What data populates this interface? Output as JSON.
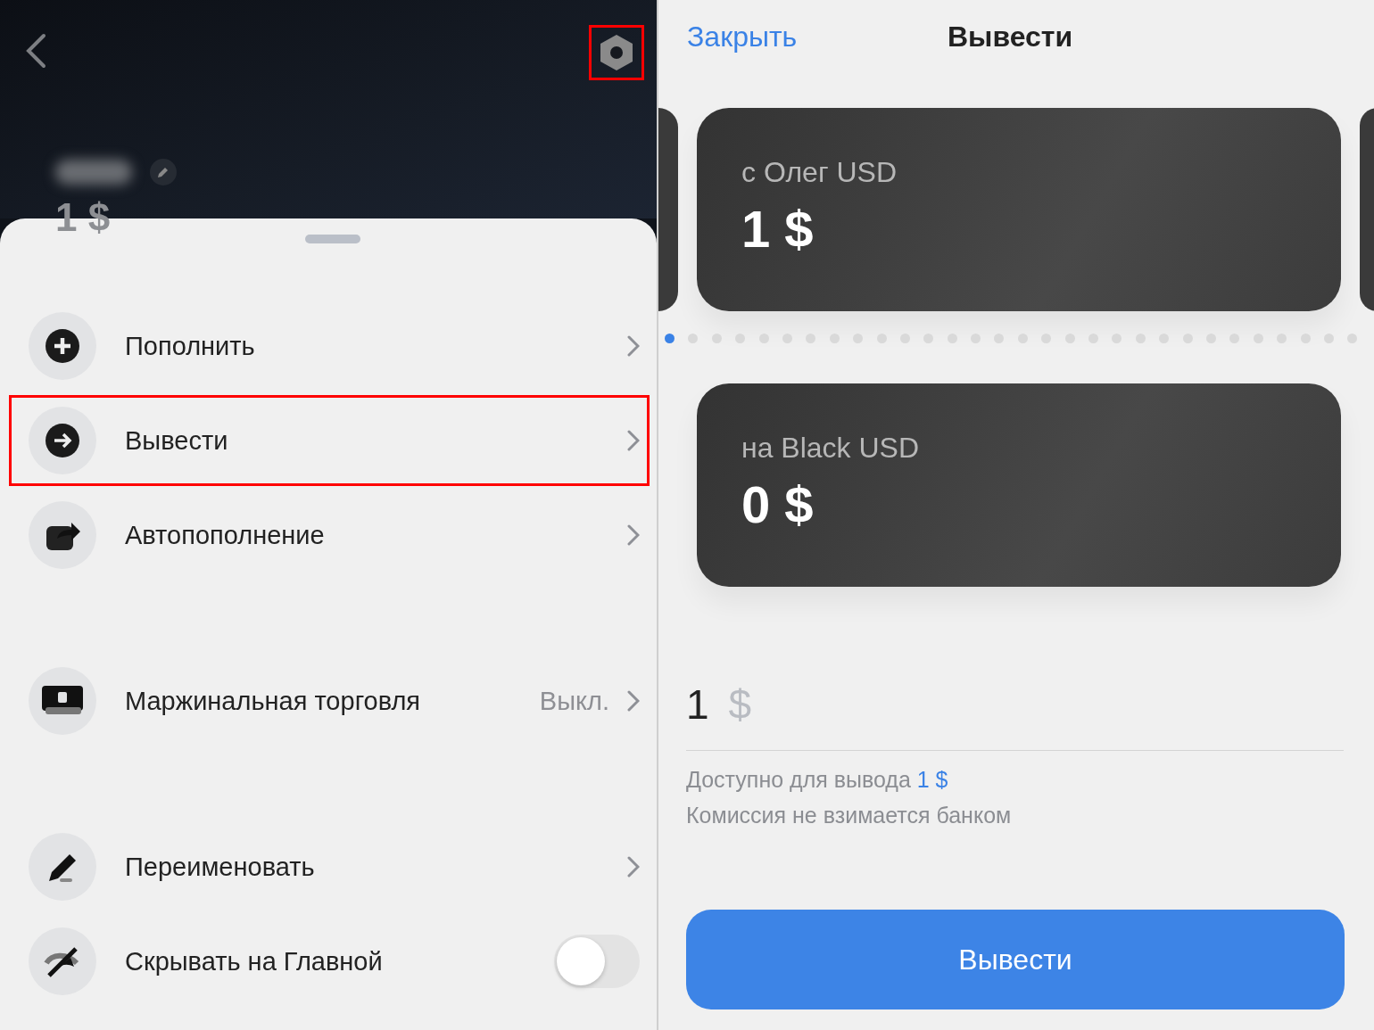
{
  "left": {
    "header": {
      "settings_highlighted": true,
      "balance": "1 $"
    },
    "menu_groups": [
      [
        {
          "kind": "link",
          "label": "Пополнить",
          "highlighted": false
        },
        {
          "kind": "link",
          "label": "Вывести",
          "highlighted": true
        },
        {
          "kind": "link",
          "label": "Автопополнение",
          "highlighted": false
        }
      ],
      [
        {
          "kind": "link",
          "label": "Маржинальная торговля",
          "value": "Выкл.",
          "highlighted": false
        }
      ],
      [
        {
          "kind": "link",
          "label": "Переименовать",
          "highlighted": false
        },
        {
          "kind": "toggle",
          "label": "Скрывать на Главной",
          "on": false,
          "highlighted": false
        }
      ]
    ]
  },
  "right": {
    "close": "Закрыть",
    "title": "Вывести",
    "cards": [
      {
        "label": "с Олег USD",
        "amount": "1 $"
      },
      {
        "label": "на Black USD",
        "amount": "0 $"
      }
    ],
    "pager": [
      {
        "selected": true
      },
      {
        "selected": false
      },
      {
        "selected": false
      },
      {
        "selected": false
      },
      {
        "selected": false
      },
      {
        "selected": false
      },
      {
        "selected": false
      },
      {
        "selected": false
      },
      {
        "selected": false
      },
      {
        "selected": false
      },
      {
        "selected": false
      },
      {
        "selected": false
      },
      {
        "selected": false
      },
      {
        "selected": false
      },
      {
        "selected": false
      },
      {
        "selected": false
      },
      {
        "selected": false
      },
      {
        "selected": false
      },
      {
        "selected": false
      },
      {
        "selected": false
      },
      {
        "selected": false
      },
      {
        "selected": false
      },
      {
        "selected": false
      },
      {
        "selected": false
      },
      {
        "selected": false
      },
      {
        "selected": false
      },
      {
        "selected": false
      },
      {
        "selected": false
      },
      {
        "selected": false
      },
      {
        "selected": false
      }
    ],
    "amount_field": {
      "value": "1",
      "currency": "$"
    },
    "available_label": "Доступно для вывода",
    "available_amount": "1 $",
    "note": "Комиссия не взимается банком",
    "submit": "Вывести"
  }
}
